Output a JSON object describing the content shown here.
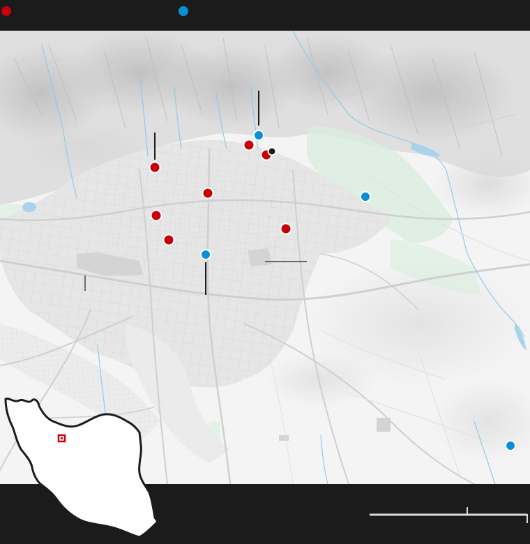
{
  "map": {
    "title": "",
    "colors": {
      "frame": "#1b1b1b",
      "land": "#f4f4f4",
      "mountain_shade": "#c9c9c9",
      "urban": "#e2e2e2",
      "roads": "#d0d0d0",
      "parks": "#d8eedd",
      "water": "#8ecae6",
      "leader": "#1b1b1b"
    },
    "legend": {
      "red_marker": {
        "color": "#c8000a",
        "label": ""
      },
      "blue_marker": {
        "color": "#0a8fd6",
        "label": ""
      }
    },
    "markers": [
      {
        "id": "red-1",
        "type": "red"
      },
      {
        "id": "red-2",
        "type": "red"
      },
      {
        "id": "red-3",
        "type": "red"
      },
      {
        "id": "red-4",
        "type": "red"
      },
      {
        "id": "red-5",
        "type": "red"
      },
      {
        "id": "red-6",
        "type": "red"
      },
      {
        "id": "red-7",
        "type": "red"
      },
      {
        "id": "red-8",
        "type": "red"
      },
      {
        "id": "blue-1",
        "type": "blue"
      },
      {
        "id": "blue-2",
        "type": "blue"
      },
      {
        "id": "blue-3",
        "type": "blue"
      },
      {
        "id": "blue-4",
        "type": "blue"
      },
      {
        "id": "black-1",
        "type": "black"
      }
    ],
    "inset": {
      "country_fill": "#ffffff",
      "country_stroke": "#1b1b1b",
      "locator_color": "#c8000a"
    },
    "scale_bar": {
      "color": "#dcdcdc"
    }
  }
}
